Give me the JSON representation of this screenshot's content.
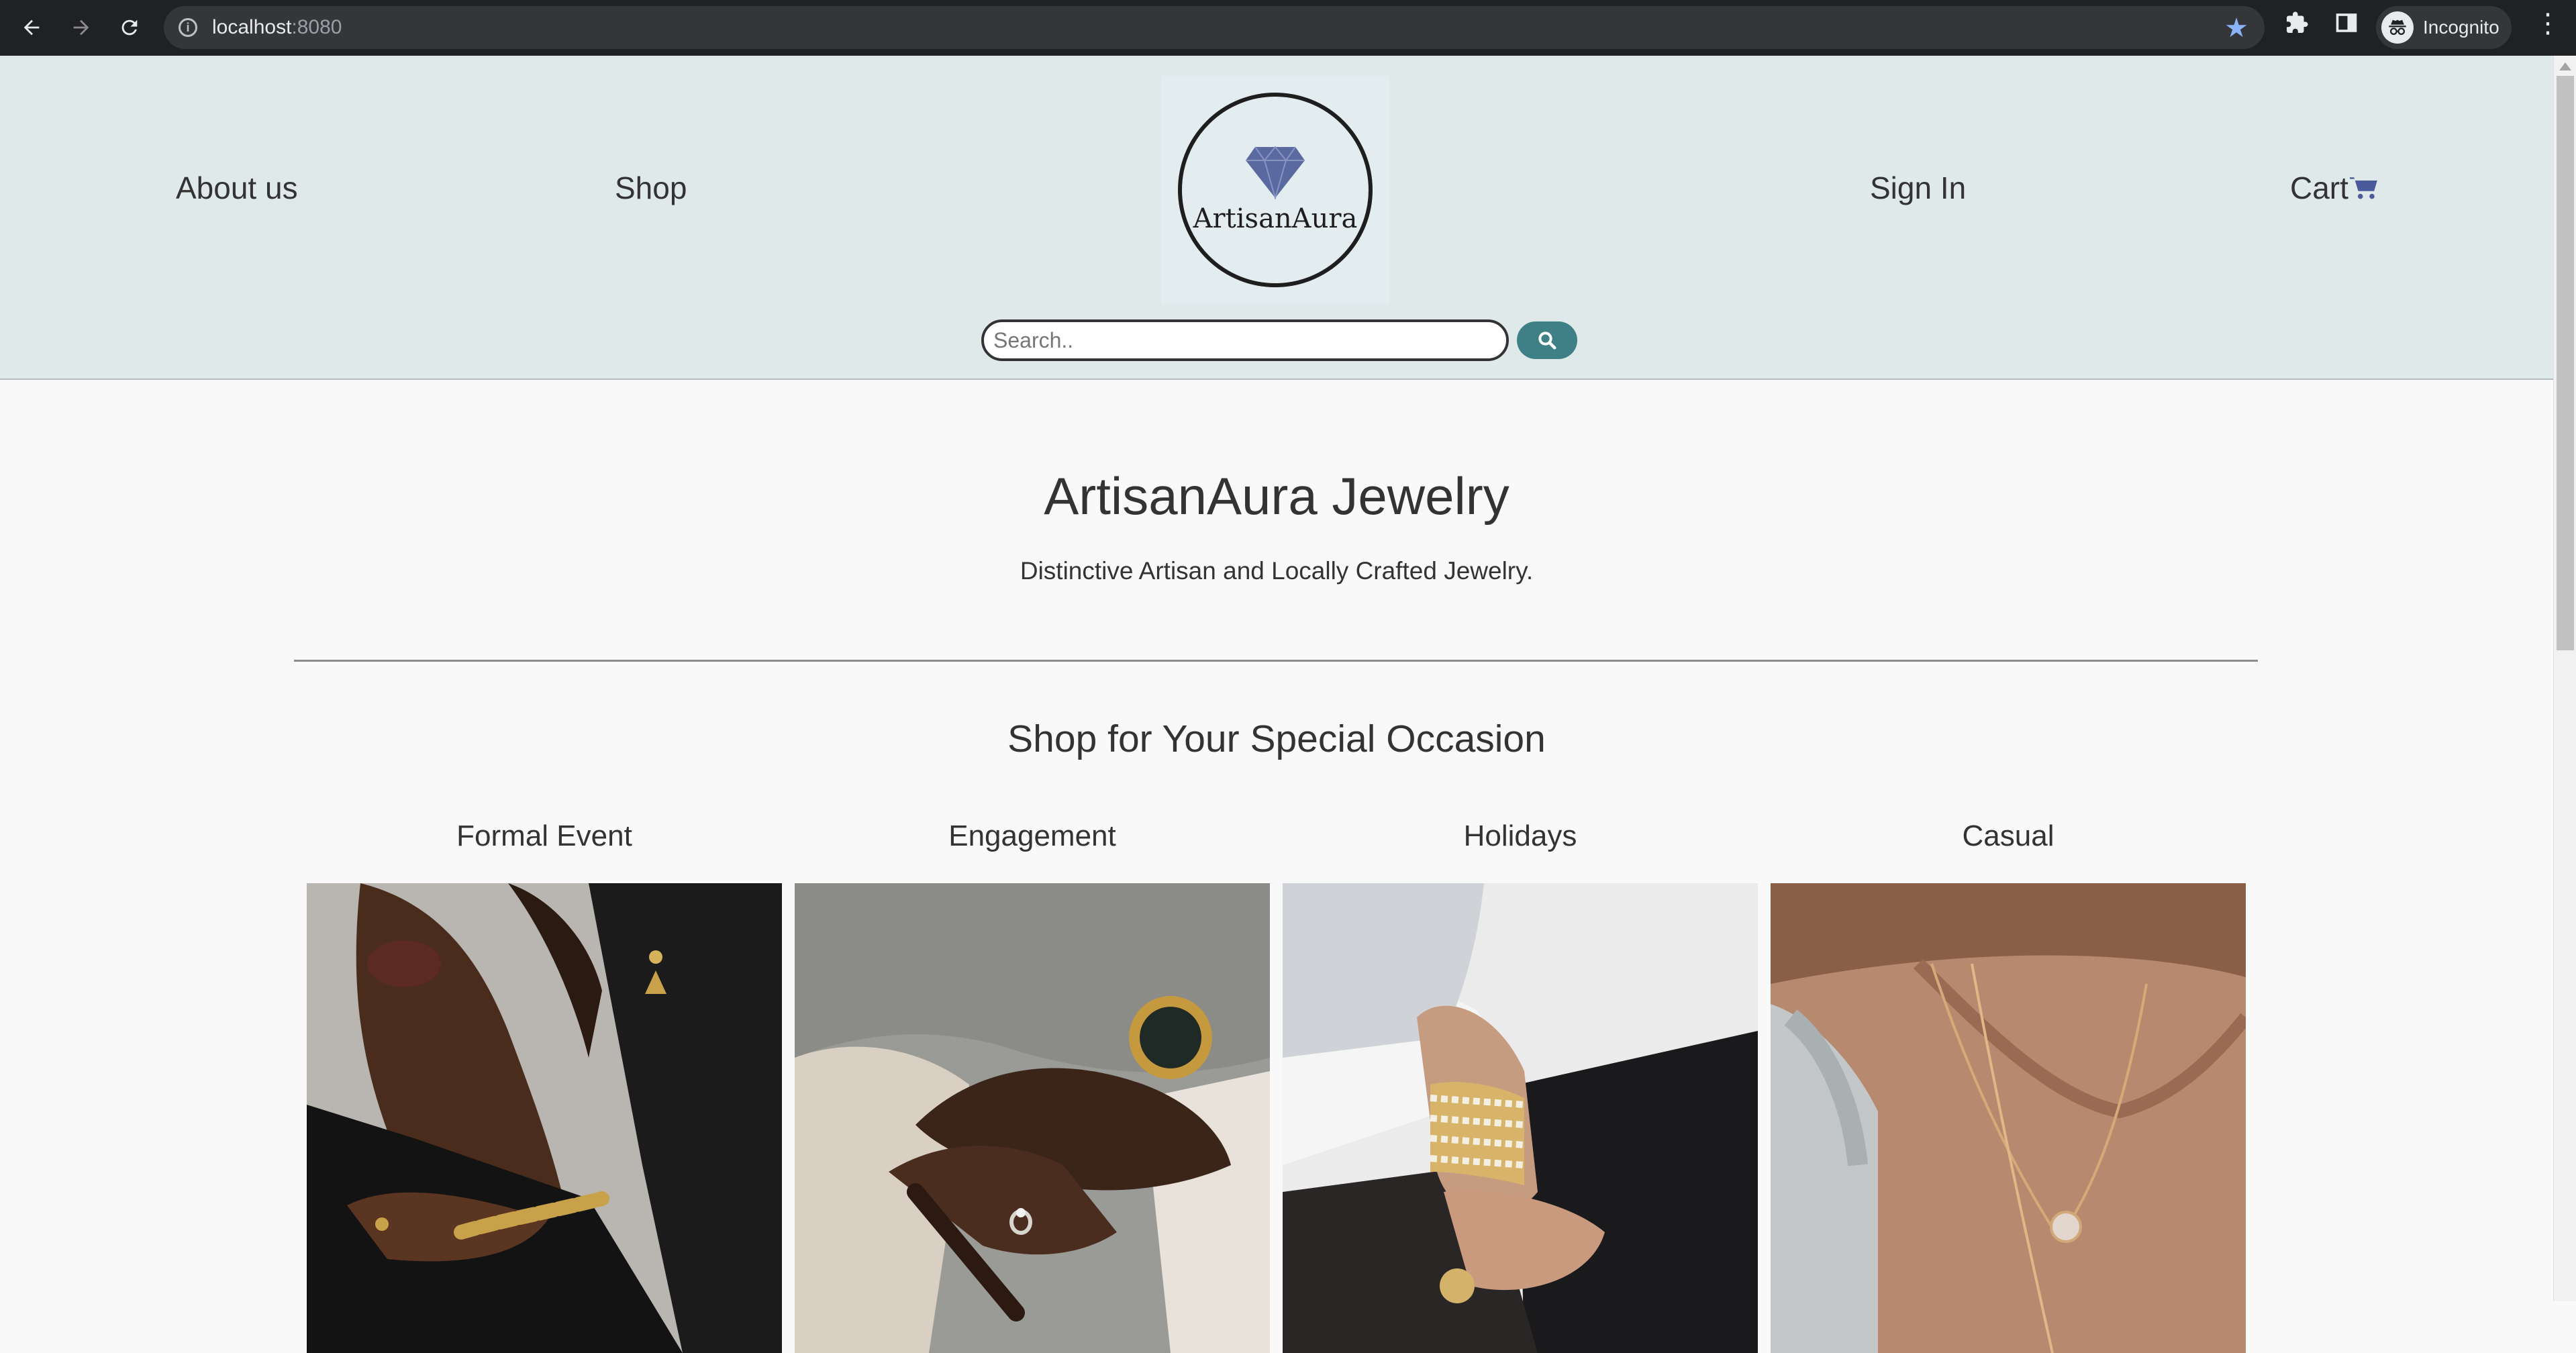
{
  "browser": {
    "url_host": "localhost",
    "url_port": ":8080",
    "profile_label": "Incognito",
    "icons": {
      "back": "arrow-left-icon",
      "forward": "arrow-right-icon",
      "reload": "reload-icon",
      "site_info": "info-icon",
      "bookmark": "star-icon",
      "extensions": "puzzle-icon",
      "side_panel": "side-panel-icon",
      "menu": "kebab-menu-icon"
    }
  },
  "header": {
    "nav": {
      "about": "About us",
      "shop": "Shop",
      "sign_in": "Sign In",
      "cart": "Cart"
    },
    "logo": {
      "name": "ArtisanAura"
    },
    "search": {
      "placeholder": "Search..",
      "value": ""
    },
    "colors": {
      "header_bg": "#dfe9ea",
      "search_button": "#3f8087",
      "cart_icon": "#4a5a9a",
      "diamond": "#5a6aa0"
    }
  },
  "hero": {
    "title": "ArtisanAura Jewelry",
    "subtitle": "Distinctive Artisan and Locally Crafted Jewelry."
  },
  "occasions": {
    "title": "Shop for Your Special Occasion",
    "items": [
      {
        "name": "Formal Event"
      },
      {
        "name": "Engagement"
      },
      {
        "name": "Holidays"
      },
      {
        "name": "Casual"
      }
    ]
  }
}
